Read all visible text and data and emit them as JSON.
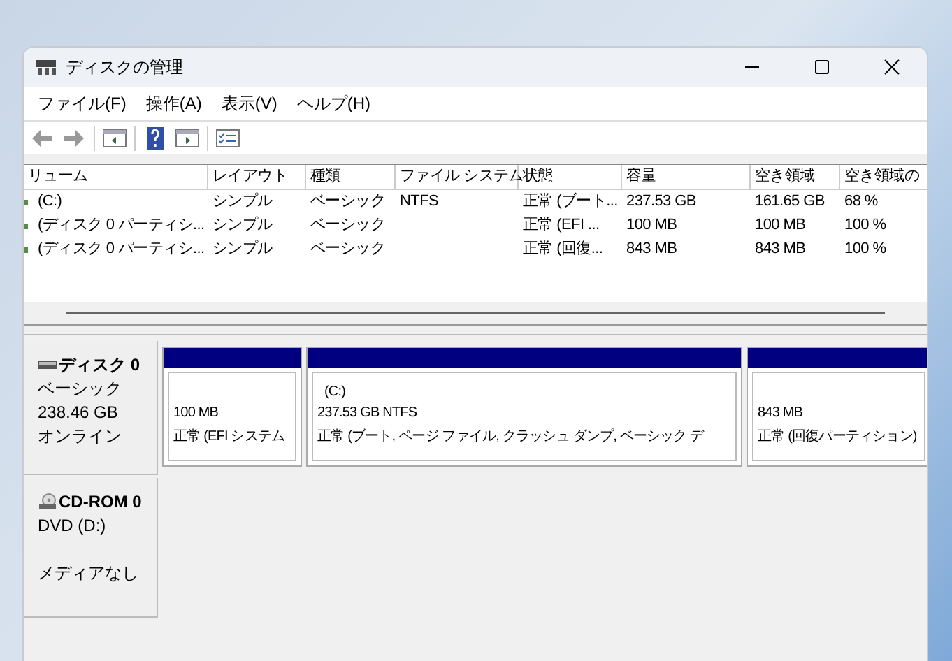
{
  "window": {
    "title": "ディスクの管理"
  },
  "menu": [
    "ファイル(F)",
    "操作(A)",
    "表示(V)",
    "ヘルプ(H)"
  ],
  "table": {
    "columns": [
      "リューム",
      "レイアウト",
      "種類",
      "ファイル システム",
      "状態",
      "容量",
      "空き領域",
      "空き領域の"
    ],
    "rows": [
      [
        "(C:)",
        "シンプル",
        "ベーシック",
        "NTFS",
        "正常 (ブート...",
        "237.53 GB",
        "161.65 GB",
        "68 %"
      ],
      [
        "(ディスク 0 パーティシ...",
        "シンプル",
        "ベーシック",
        "",
        "正常 (EFI ...",
        "100 MB",
        "100 MB",
        "100 %"
      ],
      [
        "(ディスク 0 パーティシ...",
        "シンプル",
        "ベーシック",
        "",
        "正常 (回復...",
        "843 MB",
        "843 MB",
        "100 %"
      ]
    ]
  },
  "disks": [
    {
      "kind": "disk",
      "name": "ディスク 0",
      "lines": [
        "ベーシック",
        "238.46 GB",
        "オンライン"
      ],
      "partitions": [
        {
          "size": "100 MB",
          "status": "正常 (EFI システム"
        },
        {
          "label": "(C:)",
          "size": "237.53 GB NTFS",
          "status": "正常 (ブート, ページ ファイル, クラッシュ ダンプ, ベーシック デ"
        },
        {
          "size": "843 MB",
          "status": "正常 (回復パーティション)"
        }
      ]
    },
    {
      "kind": "cdrom",
      "name": "CD-ROM 0",
      "lines": [
        "DVD (D:)",
        "メディアなし"
      ]
    }
  ]
}
